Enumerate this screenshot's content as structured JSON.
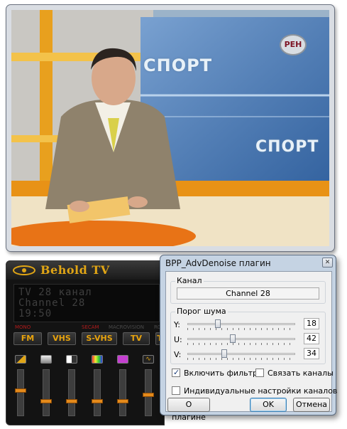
{
  "video": {
    "promo_text_1": "СПОРТ",
    "promo_text_2": "СПОРТ",
    "channel_logo": "РЕН"
  },
  "behold": {
    "brand": "Behold TV",
    "lcd": [
      "TV 28 канал",
      "Channel 28",
      "19:50"
    ],
    "status": {
      "mono": "MONO",
      "secam": "SECAM",
      "macrovision": "MACROVISION",
      "rc": "RC"
    },
    "modes": [
      "FM",
      "VHS",
      "S-VHS",
      "TV",
      "T"
    ],
    "accent_color": "#e8a30d",
    "slider_icons": [
      "brightness-icon",
      "contrast-icon",
      "gamma-icon",
      "color-bars-icon",
      "hue-icon",
      "volume-wave-icon",
      "sharpness-icon"
    ],
    "slider_levels": [
      0.55,
      0.3,
      0.3,
      0.3,
      0.3,
      0.45,
      0.45
    ]
  },
  "dialog": {
    "title": "BPP_AdvDenoise плагин",
    "close_glyph": "✕",
    "channel_group": "Канал",
    "channel_value": "Channel 28",
    "noise_group": "Порог шума",
    "y_label": "Y:",
    "u_label": "U:",
    "v_label": "V:",
    "y_value": "18",
    "u_value": "42",
    "v_value": "34",
    "enable_filter": "Включить фильтр",
    "enable_filter_checked": true,
    "link_channels": "Связать каналы",
    "link_channels_checked": false,
    "per_channel": "Индивидуальные настройки каналов",
    "per_channel_checked": false,
    "about_button": "О плагине",
    "ok_button": "OK",
    "cancel_button": "Отмена"
  }
}
